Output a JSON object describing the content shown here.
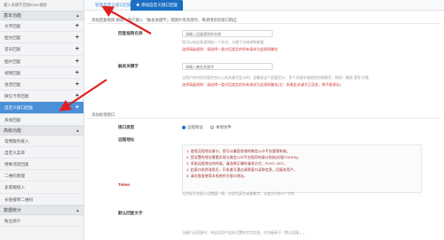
{
  "sidebar": {
    "top_text": "输入关键字后按Enter搜索",
    "groups": [
      {
        "label": "基本功能",
        "caret": "▲"
      },
      {
        "label": "高级功能",
        "caret": "▲"
      },
      {
        "label": "数据统计",
        "caret": "▲"
      }
    ],
    "items_a": [
      {
        "label": "文字回复",
        "plus": "+"
      },
      {
        "label": "图文回复",
        "plus": "+"
      },
      {
        "label": "音乐回复",
        "plus": "+"
      },
      {
        "label": "图片回复",
        "plus": "+"
      },
      {
        "label": "视频回复",
        "plus": "+"
      },
      {
        "label": "语音回复",
        "plus": "+"
      },
      {
        "label": "微信卡券回复",
        "plus": "+"
      },
      {
        "label": "自定义接口回复",
        "plus": "+"
      },
      {
        "label": "系统回复",
        "plus": ""
      }
    ],
    "items_b": [
      {
        "label": "常用服务接入"
      },
      {
        "label": "自定义菜单"
      },
      {
        "label": "特殊消息回复"
      },
      {
        "label": "二维码管理"
      },
      {
        "label": "多客服接入"
      },
      {
        "label": "长链接转二维码"
      }
    ],
    "items_c": [
      {
        "label": "粉丝统计"
      }
    ]
  },
  "tabs": {
    "tab1": "管理自定义接口回复",
    "tab2": "✚ 添加自定义接口回复"
  },
  "sections": {
    "trigger": "添加回复规则  规则：用户输入「触发关键字」或图片等消息时，将调用您的接口响应",
    "interface": "添加处理接口"
  },
  "form": {
    "rule_name_label": "回复规则名称",
    "rule_name_placeholder": "请输入回复规则的名称",
    "rule_name_hint": "您可以给这条规则起一个名字，方便下次修改和查看",
    "rule_name_warn": "选择高级规则：请选择一类对话类型的所有请求为此规则触发",
    "keyword_label": "触发关键字",
    "keyword_placeholder": "请输入触发关键字",
    "keyword_hint": "当用户的对话内容符合以上的关键字定义时，会触发这个回复定义。多个关键字请使用空格隔开，例如：美丽 漂亮 好看",
    "keyword_warn": "选择高级规则：请选择一类对话类型的所有请求为此规则触发(注：如果此关键字已添加，将不能保存)",
    "type_label": "接口类型",
    "type_opt1": "远程地址",
    "type_opt2": "本地文件",
    "url_label": "远程地址",
    "url_box_lines": [
      "1. 使用远程地址接口，您可以兼容其他的微信公众平台管理系统。",
      "2. 您设置的地址需要实现与微信公众平台相同的接口机制(对接TOKEN)。",
      "3. 添加远程地址的时候，请选择正确的请求方式：POST, GET。",
      "4. 此接口收到消息后，开发者可通过调用接口读取信息，回复给用户。",
      "5. 请勿直接使用本系统作为接口地址。"
    ],
    "token_label": "Token",
    "token_hint": "与目标平台接入设置值一致，必须为英文或者数字，长度为3到32个字符",
    "default_label": "默认回复文字",
    "default_hint": "当接口无回复时，则返回用户此处设置的文字信息，优先级高于「默认回复」。"
  }
}
